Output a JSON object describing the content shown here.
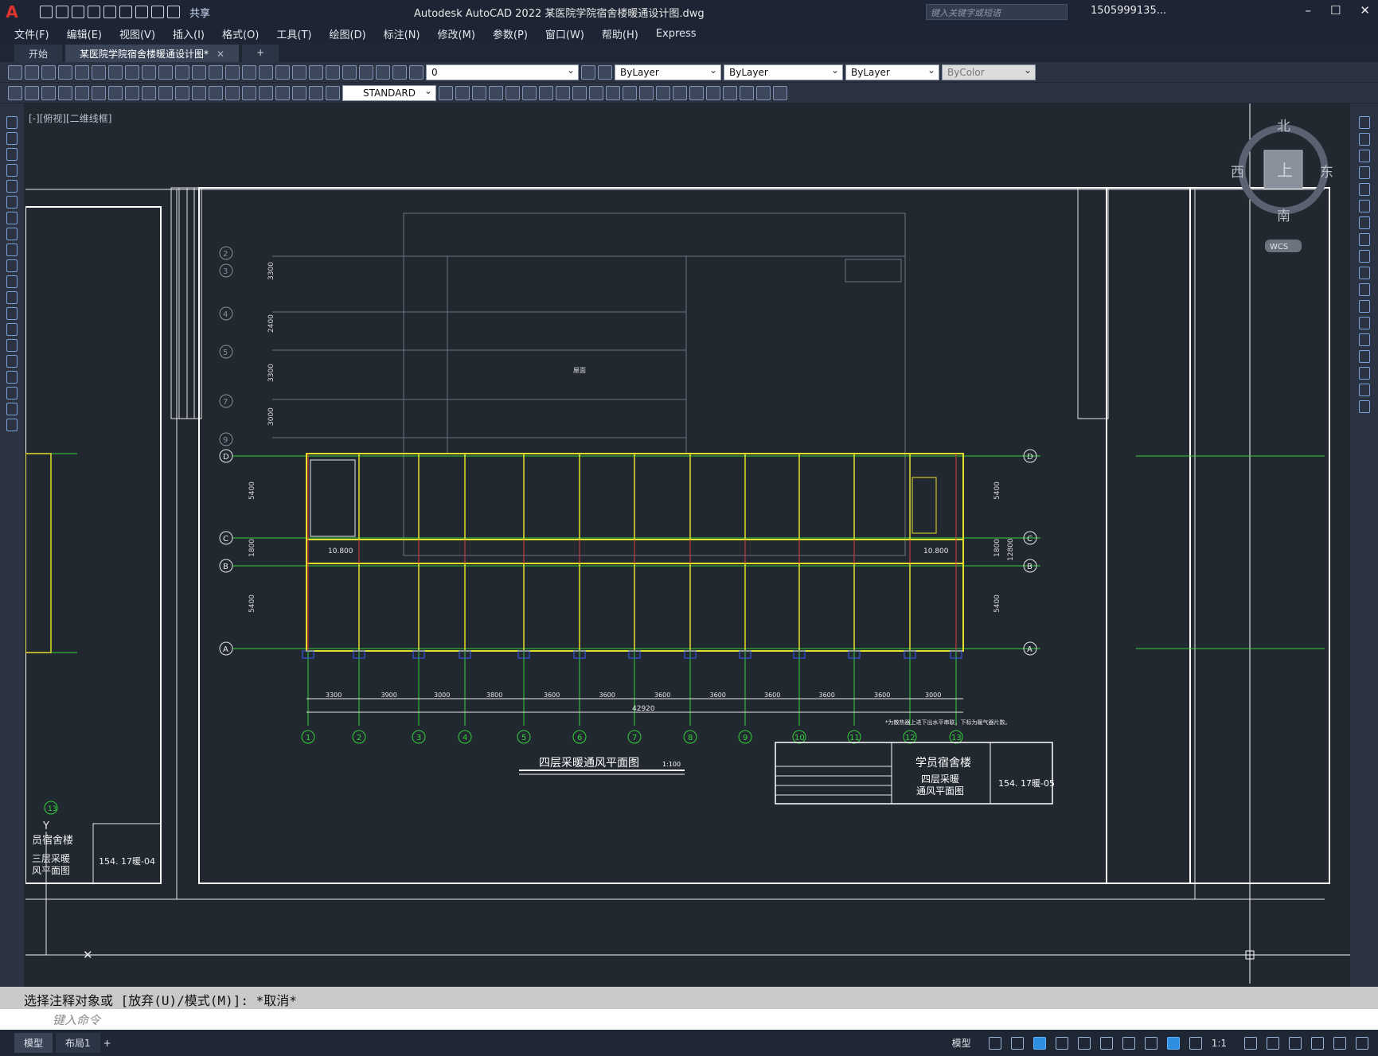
{
  "app": {
    "window_title": "Autodesk AutoCAD 2022    某医院学院宿舍楼暖通设计图.dwg",
    "search_placeholder": "键入关键字或短语",
    "user": "1505999135...",
    "share_label": "共享"
  },
  "menu": [
    "文件(F)",
    "编辑(E)",
    "视图(V)",
    "插入(I)",
    "格式(O)",
    "工具(T)",
    "绘图(D)",
    "标注(N)",
    "修改(M)",
    "参数(P)",
    "窗口(W)",
    "帮助(H)",
    "Express"
  ],
  "tabs": [
    {
      "label": "开始"
    },
    {
      "label": "某医院学院宿舍楼暖通设计图*"
    }
  ],
  "layer_props": {
    "layer": "0",
    "color": "ByLayer",
    "linetype": "ByLayer",
    "lineweight": "ByLayer",
    "plotstyle": "ByColor",
    "text_style": "STANDARD"
  },
  "viewport_label": "[-][俯视][二维线框]",
  "viewcube": {
    "north": "北",
    "south": "南",
    "east": "东",
    "west": "西",
    "top": "上",
    "wcs": "WCS"
  },
  "drawing": {
    "main_title": "四层采暖通风平面图",
    "scale": "1:100",
    "left_title": "三层采暖\n通风平面图",
    "project": "学员宿舍楼",
    "sheet_title_1": "四层采暖",
    "sheet_title_2": "通风平面图",
    "sheet_no": "154. 17暖-05",
    "left_sheet_no": "154. 17暖-04",
    "left_project": "员宿舍楼",
    "left_sheet_title_1": "三层采暖",
    "left_sheet_title_2": "风平面图",
    "total_dim": "42920",
    "bay_dims": [
      "3300",
      "3900",
      "3000",
      "3800",
      "3600",
      "3600",
      "3600",
      "3600",
      "3600",
      "3600",
      "3600",
      "3000"
    ],
    "col_labels": [
      "1",
      "2",
      "3",
      "4",
      "5",
      "6",
      "7",
      "8",
      "9",
      "10",
      "11",
      "12",
      "13"
    ],
    "row_labels": [
      "D",
      "C",
      "B",
      "A"
    ],
    "upper_labels": [
      "2",
      "3",
      "4",
      "5",
      "7",
      "9"
    ],
    "side_dims": [
      "5400",
      "1800",
      "5400",
      "12800"
    ],
    "upper_dims": [
      "3300",
      "2400",
      "3300",
      "3000"
    ],
    "elev": "10.800",
    "note": "*为散热器上进下出水平串联，下标为暖气器片数。"
  },
  "command": {
    "history": "选择注释对象或 [放弃(U)/模式(M)]: *取消*",
    "placeholder": "键入命令"
  },
  "status": {
    "layout_tabs": [
      "模型",
      "布局1"
    ],
    "model_label": "模型",
    "scale": "1:1"
  }
}
